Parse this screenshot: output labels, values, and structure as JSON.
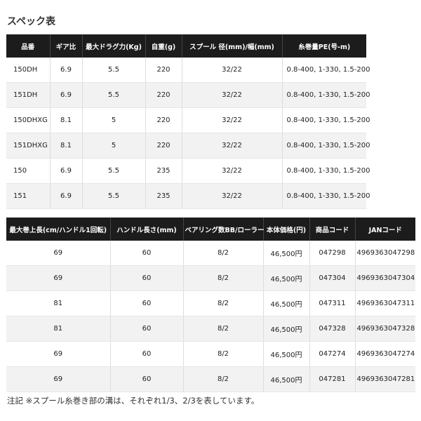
{
  "section_title": "スペック表",
  "spec_table": {
    "headers": [
      "品番",
      "ギア比",
      "最大ドラグ力(Kg)",
      "自重(g)",
      "スプール 径(mm)/幅(mm)",
      "糸巻量PE(号-m)"
    ],
    "rows": [
      [
        "150DH",
        "6.9",
        "5.5",
        "220",
        "32/22",
        "0.8-400, 1-330, 1.5-200"
      ],
      [
        "151DH",
        "6.9",
        "5.5",
        "220",
        "32/22",
        "0.8-400, 1-330, 1.5-200"
      ],
      [
        "150DHXG",
        "8.1",
        "5",
        "220",
        "32/22",
        "0.8-400, 1-330, 1.5-200"
      ],
      [
        "151DHXG",
        "8.1",
        "5",
        "220",
        "32/22",
        "0.8-400, 1-330, 1.5-200"
      ],
      [
        "150",
        "6.9",
        "5.5",
        "235",
        "32/22",
        "0.8-400, 1-330, 1.5-200"
      ],
      [
        "151",
        "6.9",
        "5.5",
        "235",
        "32/22",
        "0.8-400, 1-330, 1.5-200"
      ]
    ]
  },
  "detail_table": {
    "headers": [
      "最大巻上長(cm/ハンドル1回転)",
      "ハンドル長さ(mm)",
      "ベアリング数BB/ローラー",
      "本体価格(円)",
      "商品コード",
      "JANコード"
    ],
    "rows": [
      [
        "69",
        "60",
        "8/2",
        "46,500円",
        "047298",
        "4969363047298"
      ],
      [
        "69",
        "60",
        "8/2",
        "46,500円",
        "047304",
        "4969363047304"
      ],
      [
        "81",
        "60",
        "8/2",
        "46,500円",
        "047311",
        "4969363047311"
      ],
      [
        "81",
        "60",
        "8/2",
        "46,500円",
        "047328",
        "4969363047328"
      ],
      [
        "69",
        "60",
        "8/2",
        "46,500円",
        "047274",
        "4969363047274"
      ],
      [
        "69",
        "60",
        "8/2",
        "46,500円",
        "047281",
        "4969363047281"
      ]
    ]
  },
  "footnote": "注記 ※スプール糸巻き部の溝は、それぞれ1/3、2/3を表しています。"
}
